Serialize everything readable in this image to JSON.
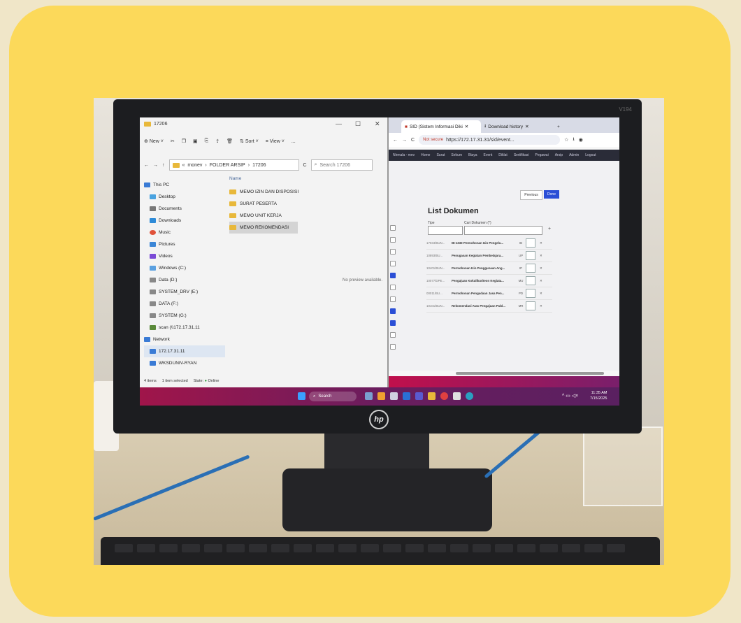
{
  "monitor": {
    "model": "V194",
    "brand_logo": "hp"
  },
  "explorer": {
    "window_title": "17206",
    "toolbar": {
      "new_label": "New",
      "sort_label": "Sort",
      "view_label": "View",
      "more_label": "..."
    },
    "breadcrumb": {
      "prefix": "«",
      "path": [
        "monev",
        "FOLDER ARSIP",
        "17206"
      ]
    },
    "search_placeholder": "Search 17206",
    "nav": [
      {
        "label": "This PC"
      },
      {
        "label": "Desktop"
      },
      {
        "label": "Documents"
      },
      {
        "label": "Downloads"
      },
      {
        "label": "Music"
      },
      {
        "label": "Pictures"
      },
      {
        "label": "Videos"
      },
      {
        "label": "Windows (C:)"
      },
      {
        "label": "Data (D:)"
      },
      {
        "label": "SYSTEM_DRV (E:)"
      },
      {
        "label": "DATA (F:)"
      },
      {
        "label": "SYSTEM (G:)"
      },
      {
        "label": "scan (\\\\172.17.31.11"
      },
      {
        "label": "Network"
      },
      {
        "label": "172.17.31.11"
      },
      {
        "label": "WKSDUNIV-RYAN"
      }
    ],
    "column_header": "Name",
    "files": [
      "MEMO IZIN DAN DISPOSISI",
      "SURAT PESERTA",
      "MEMO UNIT KERJA",
      "MEMO REKOMENDASI"
    ],
    "preview_text": "No preview available.",
    "status": {
      "count": "4 items",
      "selected": "1 item selected",
      "state": "State: ",
      "state_value": "Online"
    }
  },
  "browser": {
    "tabs": [
      "SID (Sistem Informasi Diki",
      "Download history"
    ],
    "url_warning": "Not secure",
    "url": "https://172.17.31.31/sid/event...",
    "site_nav": [
      "Nirmala - mev",
      "Home",
      "Surat",
      "Sekum",
      "Biaya",
      "Event",
      "Diklat",
      "Sertifikasi",
      "Pegawai",
      "Arsip",
      "Admin",
      "Logout"
    ],
    "prev_label": "Previous",
    "done_label": "Done",
    "list_title": "List Dokumen",
    "tipe_label": "Tipe",
    "cari_label": "Cari Dokumen (*)",
    "rows": [
      {
        "no": "17034/BUN...",
        "title": "IB-1333 Permohonan Izin Pengelu...",
        "code": "IB"
      },
      {
        "no": "10893/BU...",
        "title": "Penugasan Kegiatan Pembelajara...",
        "code": "UP"
      },
      {
        "no": "10401/BUN...",
        "title": "Permohonan Izin Penggunaan Ang...",
        "code": "IP"
      },
      {
        "no": "10077/DPE...",
        "title": "Pengajuan Kokulikuriteon Kegiata...",
        "code": "MU"
      },
      {
        "no": "00011/BU...",
        "title": "Permohonan Pengadaan Jasa Pen...",
        "code": "PD"
      },
      {
        "no": "10101/BUN...",
        "title": "Rekomendasi Atas Pengajuan Publ...",
        "code": "MR"
      }
    ]
  },
  "taskbar": {
    "search_label": "Search",
    "time": "11:35 AM",
    "date": "7/15/2025"
  }
}
